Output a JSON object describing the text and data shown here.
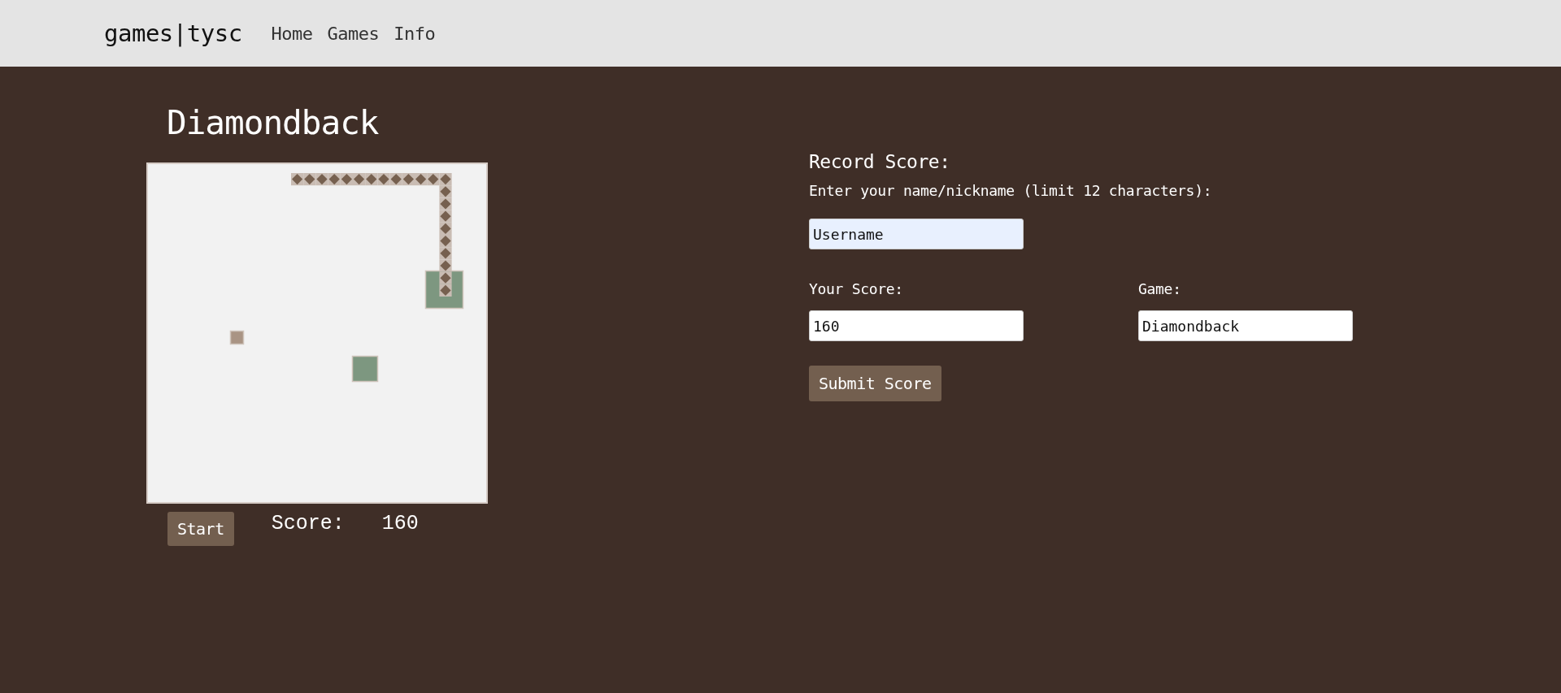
{
  "nav": {
    "brand": "games|tysc",
    "links": [
      {
        "label": "Home"
      },
      {
        "label": "Games"
      },
      {
        "label": "Info"
      }
    ]
  },
  "game": {
    "title": "Diamondback",
    "start_button": "Start",
    "score_label": "Score:",
    "score_value": "160"
  },
  "form": {
    "heading": "Record Score:",
    "name_label": "Enter your name/nickname (limit 12 characters):",
    "name_field": {
      "value": "Username",
      "autofilled": true
    },
    "score_label": "Your Score:",
    "score_field": {
      "value": "160",
      "autofilled": false
    },
    "game_label": "Game:",
    "game_field": {
      "value": "Diamondback",
      "autofilled": false
    },
    "submit_button": "Submit Score"
  }
}
